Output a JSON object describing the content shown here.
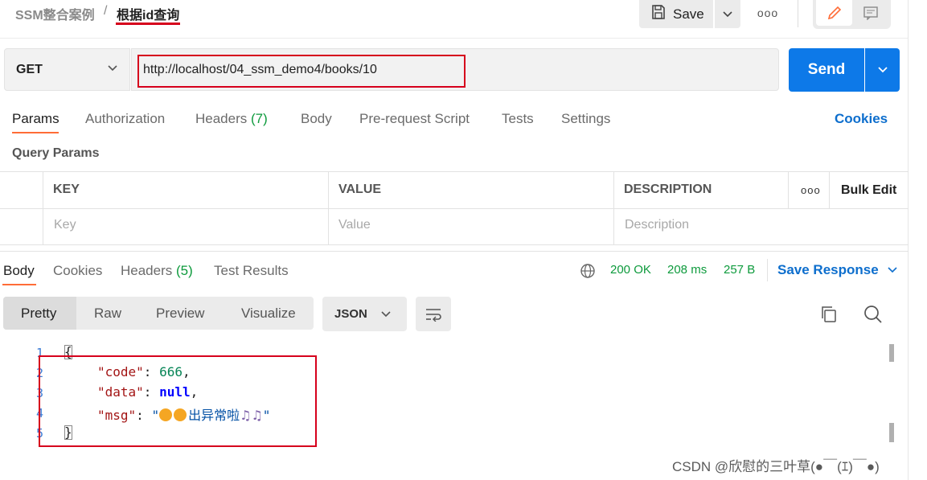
{
  "breadcrumb": {
    "parent": "SSM整合案例",
    "separator": "/",
    "current": "根据id查询"
  },
  "toolbar": {
    "save_label": "Save",
    "more_label": "ooo"
  },
  "request": {
    "method": "GET",
    "url": "http://localhost/04_ssm_demo4/books/10",
    "send_label": "Send"
  },
  "request_tabs": [
    {
      "label": "Params",
      "count": ""
    },
    {
      "label": "Authorization",
      "count": ""
    },
    {
      "label": "Headers",
      "count": "(7)"
    },
    {
      "label": "Body",
      "count": ""
    },
    {
      "label": "Pre-request Script",
      "count": ""
    },
    {
      "label": "Tests",
      "count": ""
    },
    {
      "label": "Settings",
      "count": ""
    }
  ],
  "cookies_link": "Cookies",
  "query_params": {
    "title": "Query Params",
    "columns": [
      "KEY",
      "VALUE",
      "DESCRIPTION"
    ],
    "more_label": "ooo",
    "bulk_edit": "Bulk Edit",
    "placeholders": [
      "Key",
      "Value",
      "Description"
    ]
  },
  "response_tabs": [
    {
      "label": "Body",
      "count": ""
    },
    {
      "label": "Cookies",
      "count": ""
    },
    {
      "label": "Headers",
      "count": "(5)"
    },
    {
      "label": "Test Results",
      "count": ""
    }
  ],
  "response_status": {
    "code": "200 OK",
    "time": "208 ms",
    "size": "257 B"
  },
  "save_response": "Save Response",
  "view_modes": [
    "Pretty",
    "Raw",
    "Preview",
    "Visualize"
  ],
  "format": "JSON",
  "code": {
    "line_numbers": [
      "1",
      "2",
      "3",
      "4",
      "5"
    ],
    "open_brace": "{",
    "close_brace": "}",
    "k_code": "\"code\"",
    "v_code": "666",
    "k_data": "\"data\"",
    "v_data": "null",
    "k_msg": "\"msg\"",
    "v_msg_open": "\"",
    "v_msg_text": "出异常啦",
    "v_msg_close": "\""
  },
  "watermark": "CSDN @欣慰的三叶草(●￣(ｴ)￣●)",
  "colors": {
    "accent": "#0d79e8",
    "tab_underline": "#ff6c37",
    "annotation": "#d6001c",
    "success": "#0d9a3c"
  }
}
